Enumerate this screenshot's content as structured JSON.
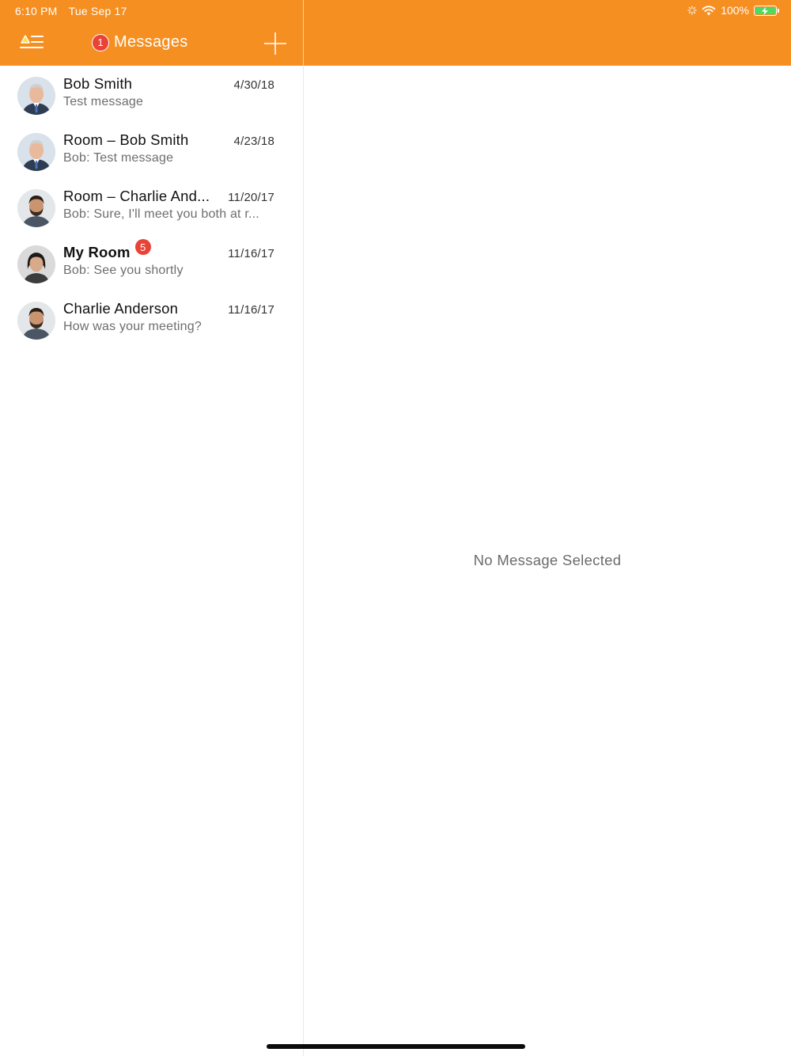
{
  "status_bar": {
    "time": "6:10 PM",
    "date": "Tue Sep 17",
    "battery": "100%",
    "icons": [
      "activity-icon",
      "wifi-icon",
      "battery-charging-icon"
    ]
  },
  "header": {
    "title": "Messages",
    "unread_count": "1",
    "menu_icon": "menu-icon",
    "add_icon": "plus-icon",
    "color": "#f68f21"
  },
  "conversations": [
    {
      "name": "Bob Smith",
      "preview": "Test message",
      "date": "4/30/18",
      "avatar": "bob-smith-avatar",
      "bold": false,
      "badge": ""
    },
    {
      "name": "Room – Bob Smith",
      "preview": "Bob: Test message",
      "date": "4/23/18",
      "avatar": "bob-smith-avatar",
      "bold": false,
      "badge": ""
    },
    {
      "name": "Room – Charlie And...",
      "preview": "Bob: Sure, I'll meet you both at r...",
      "date": "11/20/17",
      "avatar": "charlie-anderson-avatar",
      "bold": false,
      "badge": ""
    },
    {
      "name": "My Room",
      "preview": "Bob: See you shortly",
      "date": "11/16/17",
      "avatar": "woman-avatar",
      "bold": true,
      "badge": "5"
    },
    {
      "name": "Charlie Anderson",
      "preview": "How was your meeting?",
      "date": "11/16/17",
      "avatar": "charlie-anderson-avatar",
      "bold": false,
      "badge": ""
    }
  ],
  "detail": {
    "empty_text": "No Message Selected"
  },
  "colors": {
    "accent": "#f68f21",
    "badge": "#e84336"
  }
}
